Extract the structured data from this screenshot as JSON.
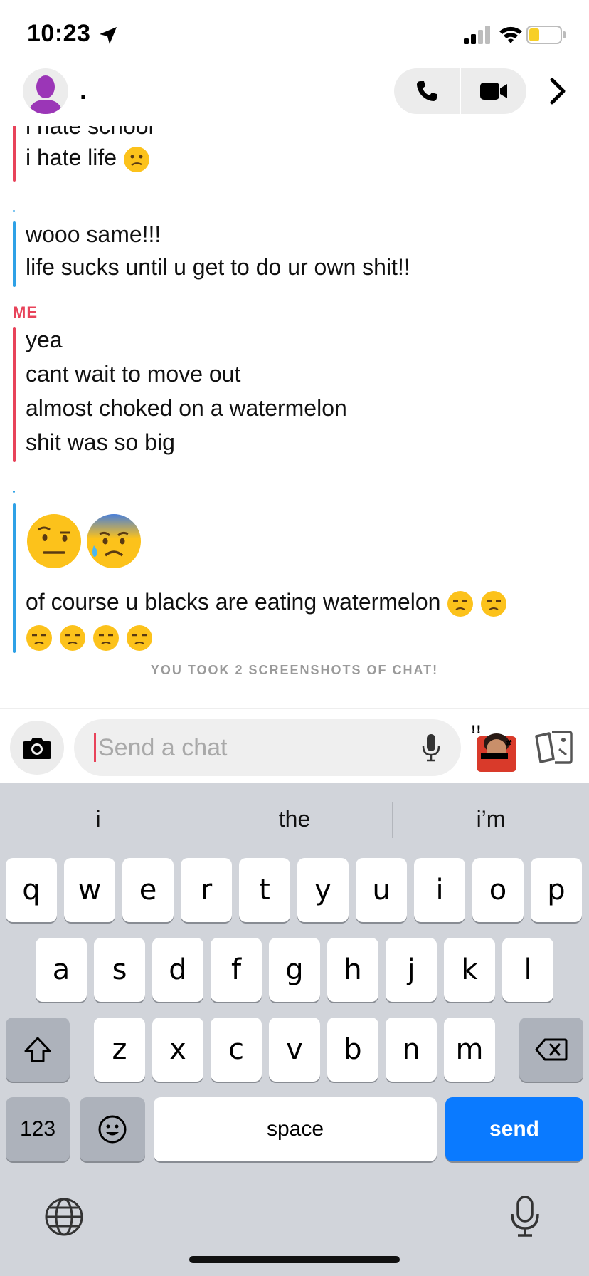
{
  "status_bar": {
    "time": "10:23",
    "icons": [
      "location-arrow-icon",
      "signal-icon",
      "wifi-icon",
      "battery-icon"
    ]
  },
  "header": {
    "contact_name": ".",
    "icons": [
      "avatar",
      "phone-icon",
      "video-icon",
      "chevron-right-icon"
    ]
  },
  "messages": {
    "group1": {
      "line1": "i hate school",
      "line2": "i hate life"
    },
    "group2": {
      "sender": ".",
      "line1": "wooo same!!!",
      "line2": "life sucks until u get to do ur own shit!!"
    },
    "group3": {
      "sender": "ME",
      "line1": "yea",
      "line2": "cant wait to move out",
      "line3": "almost choked on a watermelon",
      "line4": "shit was so big"
    },
    "group4": {
      "sender": ".",
      "line1": "of course u blacks are eating watermelon"
    },
    "notice": "YOU TOOK 2 SCREENSHOTS OF CHAT!"
  },
  "input": {
    "placeholder": "Send a chat"
  },
  "keyboard": {
    "suggestions": [
      "i",
      "the",
      "i’m"
    ],
    "row1": [
      "q",
      "w",
      "e",
      "r",
      "t",
      "y",
      "u",
      "i",
      "o",
      "p"
    ],
    "row2": [
      "a",
      "s",
      "d",
      "f",
      "g",
      "h",
      "j",
      "k",
      "l"
    ],
    "row3": [
      "z",
      "x",
      "c",
      "v",
      "b",
      "n",
      "m"
    ],
    "numbers_label": "123",
    "space_label": "space",
    "send_label": "send"
  },
  "colors": {
    "me_accent": "#e8435a",
    "friend_accent": "#2ea1e6",
    "send_blue": "#0a7aff",
    "keyboard_bg": "#d1d4da"
  }
}
